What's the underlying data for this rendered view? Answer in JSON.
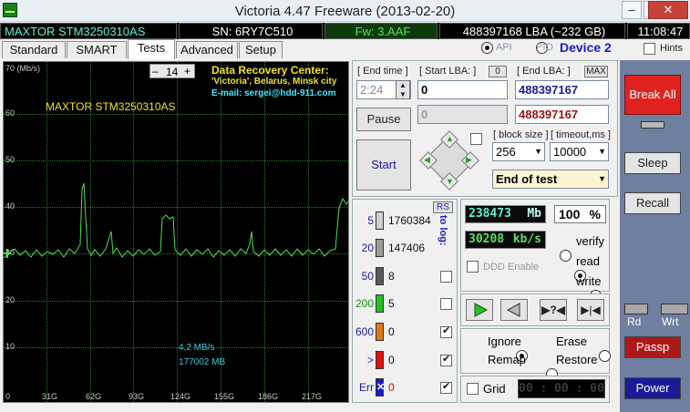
{
  "window": {
    "title": "Victoria 4.47  Freeware (2013-02-20)",
    "minimize": "–",
    "maximize": "□",
    "close": "✕"
  },
  "info": {
    "model": "MAXTOR STM3250310AS",
    "serial": "SN: 6RY7C510",
    "firmware": "Fw: 3.AAF",
    "lba": "488397168 LBA (~232 GB)",
    "time": "11:08:47"
  },
  "tabs": [
    "Standard",
    "SMART",
    "Tests",
    "Advanced",
    "Setup"
  ],
  "mode": {
    "api": "API",
    "pio": "PIO",
    "device": "Device 2",
    "hints": "Hints"
  },
  "graph": {
    "unit_label": "70 (Mb/s)",
    "zoom_minus": "–",
    "zoom_value": "14",
    "zoom_plus": "+",
    "drive_model": "MAXTOR STM3250310AS",
    "ad_title": "Data Recovery Center:",
    "ad_line1": "'Victoria', Belarus, Minsk city",
    "ad_line2": "E-mail: sergei@hdd-911.com",
    "speed_readout": "4,2 MB/s",
    "position_readout": "177002 MB",
    "y_ticks": [
      "60",
      "50",
      "40",
      "30",
      "20",
      "10",
      "0"
    ],
    "x_ticks": [
      "31G",
      "62G",
      "93G",
      "124G",
      "155G",
      "186G",
      "217G"
    ]
  },
  "controls": {
    "end_time_label": "[ End time ]",
    "end_time_value": "2:24",
    "start_lba_label": "[ Start LBA: ]",
    "start_lba_btn": "0",
    "start_lba_value": "0",
    "end_lba_label": "[ End LBA: ]",
    "end_lba_btn": "MAX",
    "end_lba_value": "488397167",
    "current_lba_value": "0",
    "current_end_lba_value": "488397167",
    "pause_label": "Pause",
    "start_label": "Start",
    "block_size_label": "[ block size ]",
    "block_size_value": "256",
    "timeout_label": "[ timeout,ms ]",
    "timeout_value": "10000",
    "end_action_value": "End of test"
  },
  "stats": {
    "rs_label": "RS",
    "to_log_label": "to log:",
    "rows": [
      {
        "label": "5",
        "count": "1760384",
        "color": "#cfcfcf"
      },
      {
        "label": "20",
        "count": "147406",
        "color": "#9a9a9a"
      },
      {
        "label": "50",
        "count": "8",
        "color": "#5a5a5a"
      },
      {
        "label": "200",
        "count": "5",
        "color": "#22c022"
      },
      {
        "label": "600",
        "count": "0",
        "color": "#e07a10"
      },
      {
        "label": ">",
        "count": "0",
        "color": "#e01010"
      },
      {
        "label": "Err",
        "count": "0",
        "color": "#1a1ad0"
      }
    ]
  },
  "progress": {
    "mb_value": "238473",
    "mb_unit": "Mb",
    "percent_value": "100",
    "percent_unit": "%",
    "speed_value": "30208",
    "speed_unit": "kb/s",
    "ddd_enable": "DDD Enable",
    "verify": "verify",
    "read": "read",
    "write": "write"
  },
  "actions": {
    "ignore": "Ignore",
    "erase": "Erase",
    "remap": "Remap",
    "restore": "Restore",
    "grid": "Grid",
    "grid_timer": "00 : 00 : 00"
  },
  "side": {
    "break_all": "Break All",
    "sleep": "Sleep",
    "recall": "Recall",
    "rd": "Rd",
    "wrt": "Wrt",
    "passp": "Passp",
    "power": "Power"
  },
  "colors": {
    "accent_blue": "#1a1acc",
    "lcd_cyan": "#5cf0d6",
    "break_red": "#e0221f",
    "graph_green": "#4ee04e"
  }
}
